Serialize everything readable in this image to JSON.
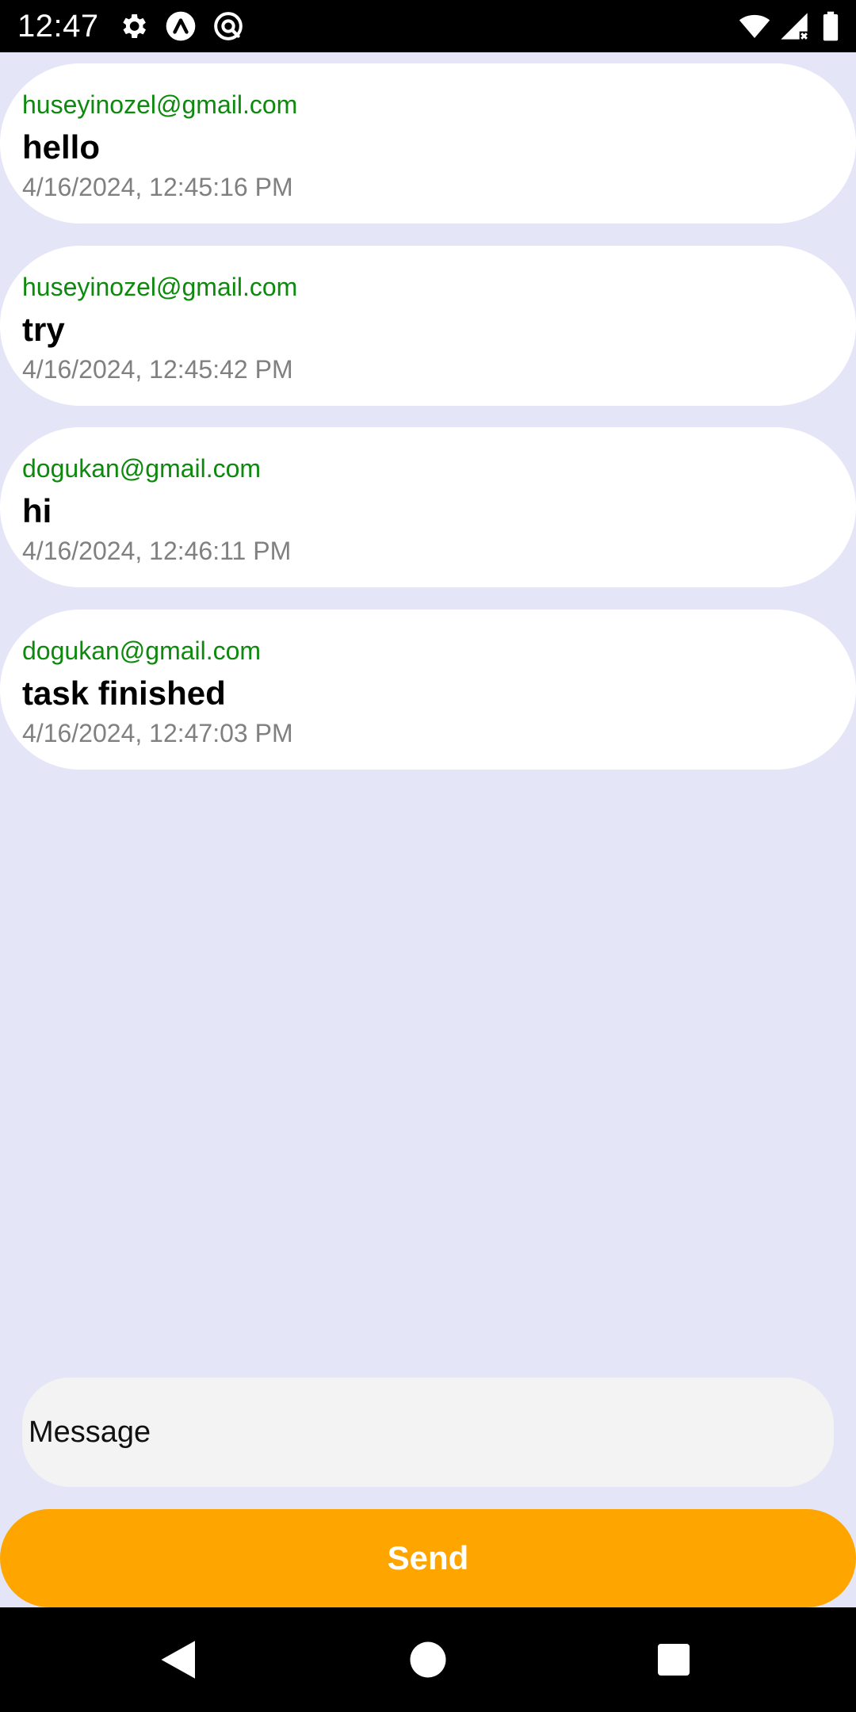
{
  "status_bar": {
    "time": "12:47",
    "icons": [
      "gear-icon",
      "app-a-icon",
      "at-sign-icon",
      "wifi-icon",
      "signal-icon",
      "battery-icon"
    ]
  },
  "messages": [
    {
      "sender": "huseyinozel@gmail.com",
      "text": "hello",
      "timestamp": "4/16/2024, 12:45:16 PM"
    },
    {
      "sender": "huseyinozel@gmail.com",
      "text": "try",
      "timestamp": "4/16/2024, 12:45:42 PM"
    },
    {
      "sender": "dogukan@gmail.com",
      "text": "hi",
      "timestamp": "4/16/2024, 12:46:11 PM"
    },
    {
      "sender": "dogukan@gmail.com",
      "text": "task finished",
      "timestamp": "4/16/2024, 12:47:03 PM"
    }
  ],
  "composer": {
    "placeholder": "Message",
    "value": "",
    "send_label": "Send"
  },
  "colors": {
    "background": "#e5e5f8",
    "card": "#ffffff",
    "sender": "#0d8a0d",
    "timestamp": "#808080",
    "input": "#f3f3f3",
    "send": "#ffa500"
  },
  "nav_bar": {
    "icons": [
      "back-icon",
      "home-icon",
      "recents-icon"
    ]
  }
}
